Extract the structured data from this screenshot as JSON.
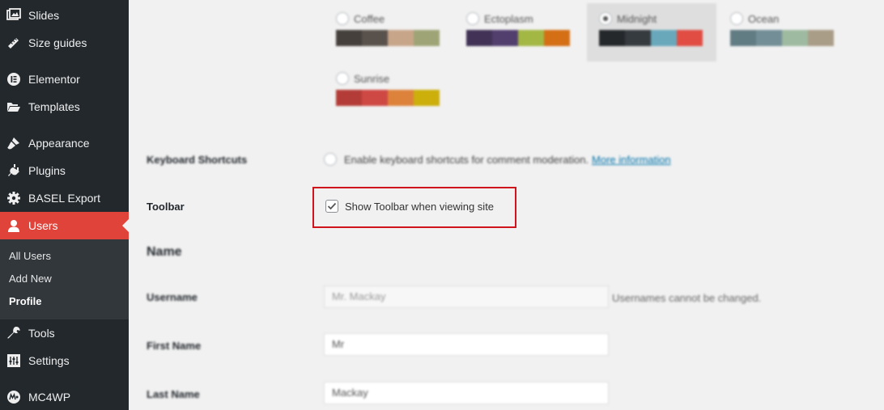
{
  "sidebar": {
    "items": [
      {
        "label": "Slides"
      },
      {
        "label": "Size guides"
      },
      {
        "label": "Elementor"
      },
      {
        "label": "Templates"
      },
      {
        "label": "Appearance"
      },
      {
        "label": "Plugins"
      },
      {
        "label": "BASEL Export"
      },
      {
        "label": "Users"
      },
      {
        "label": "Tools"
      },
      {
        "label": "Settings"
      },
      {
        "label": "MC4WP"
      }
    ],
    "submenu": [
      {
        "label": "All Users"
      },
      {
        "label": "Add New"
      },
      {
        "label": "Profile"
      }
    ]
  },
  "color_schemes": [
    {
      "name": "Coffee",
      "colors": [
        "#46403c",
        "#59524c",
        "#c7a589",
        "#9ea476"
      ]
    },
    {
      "name": "Ectoplasm",
      "colors": [
        "#413256",
        "#523f6d",
        "#a3b745",
        "#d46f15"
      ]
    },
    {
      "name": "Midnight",
      "selected": true,
      "colors": [
        "#25282b",
        "#363b3f",
        "#69a8bb",
        "#e14d43"
      ]
    },
    {
      "name": "Ocean",
      "colors": [
        "#627c83",
        "#738e96",
        "#9ebaa0",
        "#aa9d88"
      ]
    },
    {
      "name": "Sunrise",
      "colors": [
        "#b43c38",
        "#cf4944",
        "#dd823b",
        "#ccaf0b"
      ]
    }
  ],
  "keyboard_shortcuts": {
    "label": "Keyboard Shortcuts",
    "text": "Enable keyboard shortcuts for comment moderation.",
    "link": "More information"
  },
  "toolbar": {
    "label": "Toolbar",
    "checkbox_label": "Show Toolbar when viewing site",
    "checked": true
  },
  "name_section": {
    "title": "Name",
    "username": {
      "label": "Username",
      "value": "Mr. Mackay",
      "note": "Usernames cannot be changed."
    },
    "first_name": {
      "label": "First Name",
      "value": "Mr"
    },
    "last_name": {
      "label": "Last Name",
      "value": "Mackay"
    }
  },
  "colors": {
    "sidebar_bg": "#23282d",
    "submenu_bg": "#32373c",
    "active_bg": "#e0433a",
    "highlight_border": "#d0141b",
    "content_bg": "#f1f1f1"
  }
}
